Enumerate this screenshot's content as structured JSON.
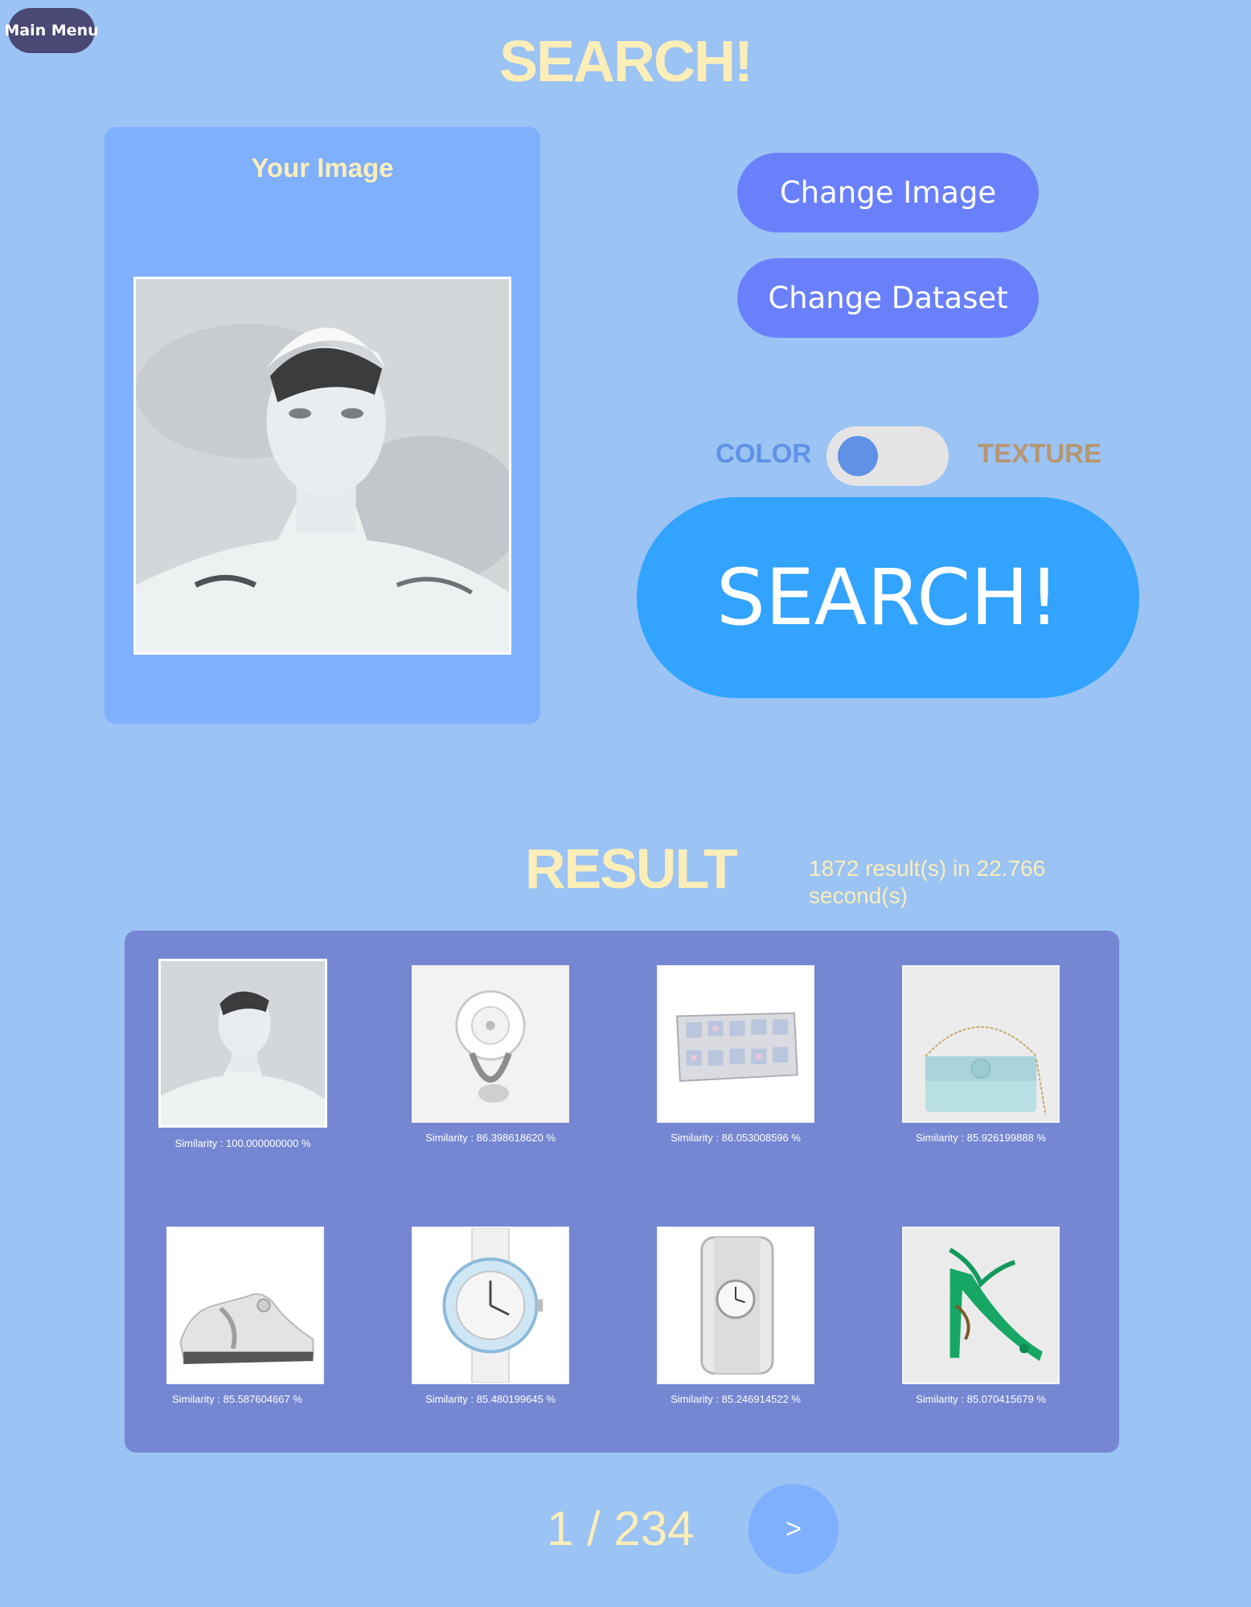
{
  "nav": {
    "main_menu_label": "Main Menu"
  },
  "header": {
    "title": "SEARCH!"
  },
  "query": {
    "label": "Your Image"
  },
  "actions": {
    "change_image_label": "Change Image",
    "change_dataset_label": "Change Dataset",
    "search_label": "SEARCH!"
  },
  "mode_toggle": {
    "left_label": "COLOR",
    "right_label": "TEXTURE",
    "selected": "COLOR"
  },
  "results": {
    "title": "RESULT",
    "stats": "1872 result(s) in 22.766 second(s)",
    "items": [
      {
        "similarity": "Similarity : 100.000000000 %"
      },
      {
        "similarity": "Similarity : 86.398618620 %"
      },
      {
        "similarity": "Similarity : 86.053008596 %"
      },
      {
        "similarity": "Similarity : 85.926199888 %"
      },
      {
        "similarity": "Similarity : 85.587604667 %"
      },
      {
        "similarity": "Similarity : 85.480199645 %"
      },
      {
        "similarity": "Similarity : 85.246914522 %"
      },
      {
        "similarity": "Similarity : 85.070415679 %"
      }
    ]
  },
  "pagination": {
    "label": "1 / 234",
    "next_label": ">"
  },
  "colors": {
    "background": "#9bc3f4",
    "accent_text": "#fbeeb8",
    "button": "#6a80fb",
    "search_button": "#32a3ff",
    "panel": "#7fb0fd",
    "results_panel": "#7587d2"
  }
}
